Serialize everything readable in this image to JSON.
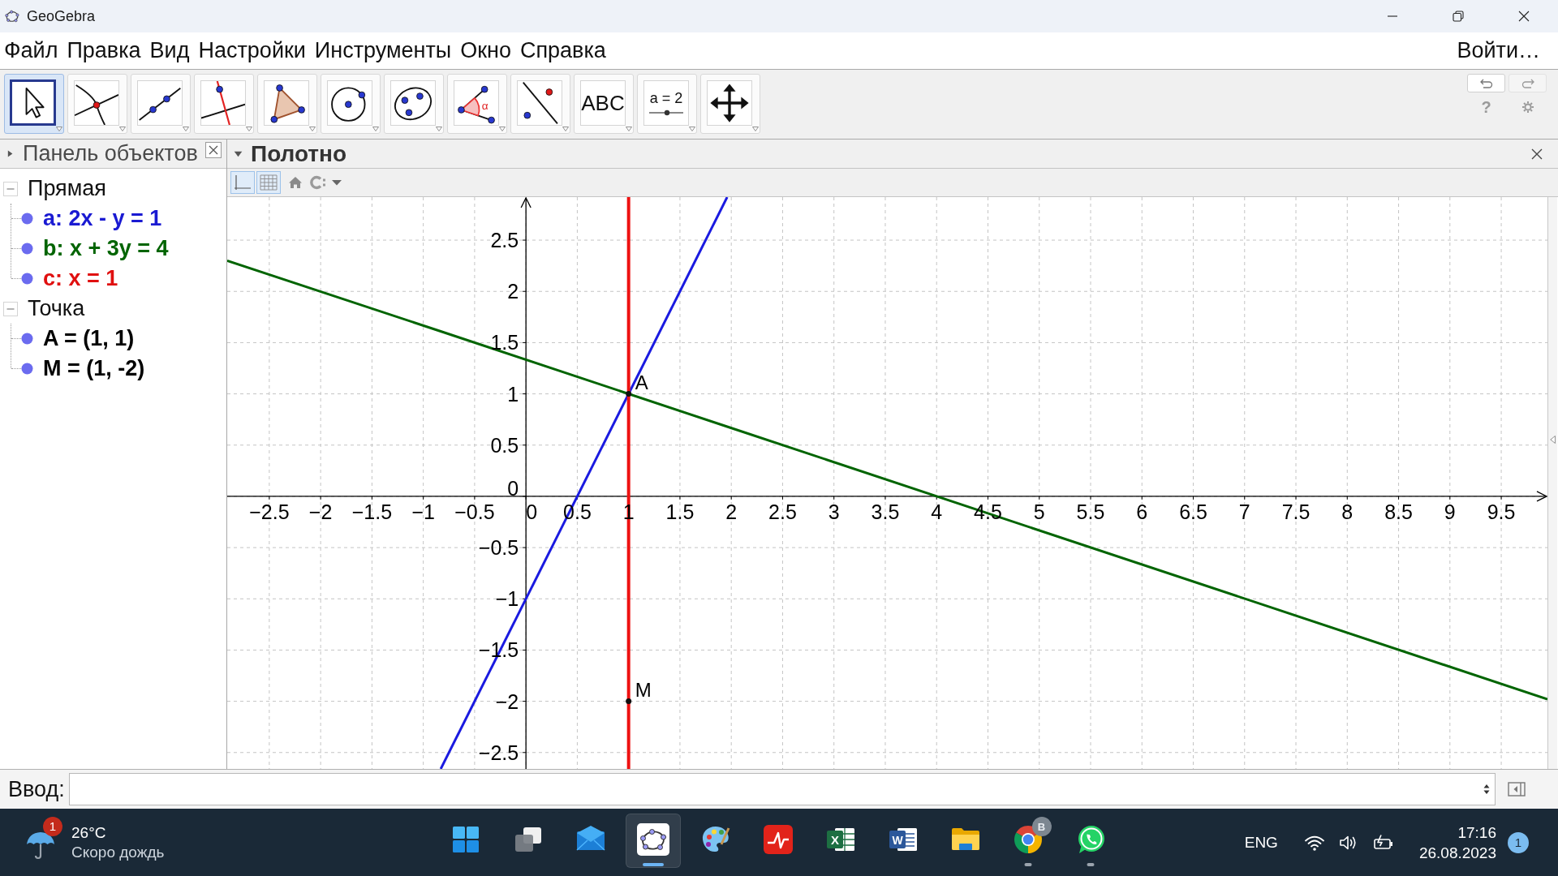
{
  "window": {
    "title": "GeoGebra"
  },
  "menu_bar": {
    "items": [
      "Файл",
      "Правка",
      "Вид",
      "Настройки",
      "Инструменты",
      "Окно",
      "Справка"
    ],
    "login": "Войти…"
  },
  "toolbar": {
    "tools": [
      {
        "kind": "move",
        "selected": true
      },
      {
        "kind": "intersect",
        "selected": false
      },
      {
        "kind": "line",
        "selected": false
      },
      {
        "kind": "perpendicular",
        "selected": false
      },
      {
        "kind": "polygon",
        "selected": false
      },
      {
        "kind": "circle",
        "selected": false
      },
      {
        "kind": "conic",
        "selected": false
      },
      {
        "kind": "angle",
        "selected": false,
        "glyph": "α"
      },
      {
        "kind": "reflect",
        "selected": false
      },
      {
        "kind": "text",
        "selected": false,
        "glyph": "ABC"
      },
      {
        "kind": "slider",
        "selected": false,
        "glyph": "a = 2"
      },
      {
        "kind": "move-view",
        "selected": false
      }
    ],
    "help": "?"
  },
  "algebra_panel": {
    "title": "Панель объектов",
    "expanded": false,
    "groups": [
      {
        "label": "Прямая",
        "expanded": true,
        "children": [
          {
            "text": "a: 2x - y = 1",
            "color": "#1a1ad2",
            "visible": true
          },
          {
            "text": "b: x + 3y = 4",
            "color": "#006400",
            "visible": true
          },
          {
            "text": "c: x = 1",
            "color": "#e01010",
            "visible": true
          }
        ]
      },
      {
        "label": "Точка",
        "expanded": true,
        "children": [
          {
            "text": "A = (1, 1)",
            "color": "#000000",
            "visible": true
          },
          {
            "text": "M = (1, -2)",
            "color": "#000000",
            "visible": true
          }
        ]
      }
    ]
  },
  "graphics_panel": {
    "title": "Полотно",
    "expanded": true,
    "style_bar": {
      "axes_on": true,
      "grid_on": true
    },
    "chart_data": {
      "type": "line",
      "grid": true,
      "x": [
        -2.91,
        -0.83,
        1.96,
        9.95
      ],
      "xlim": [
        -2.91,
        9.95
      ],
      "ylim": [
        -2.66,
        2.92
      ],
      "xticks": [
        {
          "value": -2.5,
          "label": "−2.5"
        },
        {
          "value": -2,
          "label": "−2"
        },
        {
          "value": -1.5,
          "label": "−1.5"
        },
        {
          "value": -1,
          "label": "−1"
        },
        {
          "value": -0.5,
          "label": "−0.5"
        },
        0,
        0.5,
        1,
        1.5,
        2,
        2.5,
        3,
        3.5,
        4,
        4.5,
        5,
        5.5,
        6,
        6.5,
        7,
        7.5,
        8,
        8.5,
        9,
        9.5
      ],
      "yticks": [
        {
          "value": -2.5,
          "label": "−2.5"
        },
        {
          "value": -2,
          "label": "−2"
        },
        {
          "value": -1.5,
          "label": "−1.5"
        },
        {
          "value": -1,
          "label": "−1"
        },
        {
          "value": -0.5,
          "label": "−0.5"
        },
        0,
        0.5,
        1,
        1.5,
        2,
        2.5
      ],
      "series": [
        {
          "color": "#006400",
          "values": [
            2.3,
            1.61,
            0.68,
            -1.98
          ]
        },
        {
          "color": "#1a1ae0",
          "values": [
            null,
            -2.66,
            2.92,
            null
          ]
        }
      ],
      "ref_lines": [
        {
          "axis": "x",
          "value": 1,
          "color": "#ee1111"
        }
      ],
      "annotations": [
        {
          "text": "A",
          "x": 1,
          "y": 1
        },
        {
          "text": "M",
          "x": 1,
          "y": -2
        }
      ]
    }
  },
  "input_bar": {
    "label": "Ввод:"
  },
  "taskbar": {
    "weather": {
      "badge": "1",
      "temperature": "26°C",
      "forecast": "Скоро дождь"
    },
    "apps": [
      {
        "kind": "start",
        "selected": false,
        "running": false
      },
      {
        "kind": "task-view",
        "selected": false,
        "running": false
      },
      {
        "kind": "mail",
        "selected": false,
        "running": false
      },
      {
        "kind": "geogebra",
        "selected": true,
        "running": true
      },
      {
        "kind": "paint",
        "selected": false,
        "running": false
      },
      {
        "kind": "pdf",
        "selected": false,
        "running": false
      },
      {
        "kind": "spreadsheet",
        "selected": false,
        "running": false,
        "glyph": "X"
      },
      {
        "kind": "word-processor",
        "selected": false,
        "running": false,
        "glyph": "W"
      },
      {
        "kind": "files",
        "selected": false,
        "running": false
      },
      {
        "kind": "browser",
        "selected": false,
        "running": true,
        "badge": "B"
      },
      {
        "kind": "chat",
        "selected": false,
        "running": true
      }
    ],
    "tray": {
      "language": "ENG",
      "time": "17:16",
      "date": "26.08.2023",
      "notifications": "1"
    }
  }
}
